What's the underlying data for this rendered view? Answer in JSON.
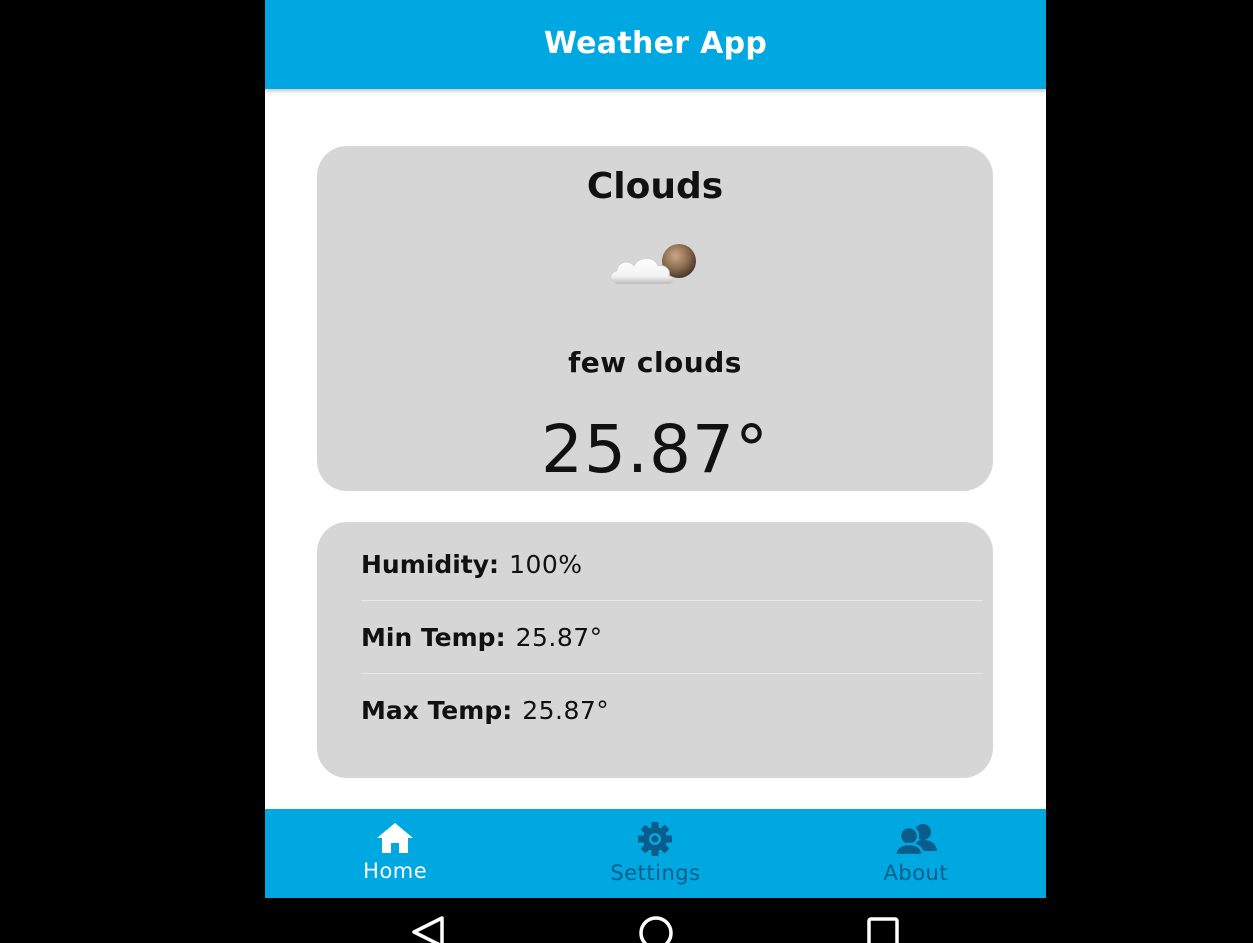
{
  "app": {
    "title": "Weather App"
  },
  "current": {
    "condition": "Clouds",
    "icon": "few-clouds-icon",
    "description": "few clouds",
    "temperature": "25.87°"
  },
  "details": [
    {
      "label": "Humidity:",
      "value": "100%"
    },
    {
      "label": "Min Temp:",
      "value": "25.87°"
    },
    {
      "label": "Max Temp:",
      "value": "25.87°"
    }
  ],
  "tabs": [
    {
      "label": "Home",
      "icon": "home-icon",
      "active": true
    },
    {
      "label": "Settings",
      "icon": "gear-icon",
      "active": false
    },
    {
      "label": "About",
      "icon": "people-icon",
      "active": false
    }
  ],
  "system_nav": [
    "back-icon",
    "home-circle-icon",
    "recents-icon"
  ],
  "colors": {
    "primary": "#00a8e2",
    "card": "#d6d6d6",
    "inactive_tab": "#0a5d8a",
    "active_tab": "#ffffff"
  }
}
